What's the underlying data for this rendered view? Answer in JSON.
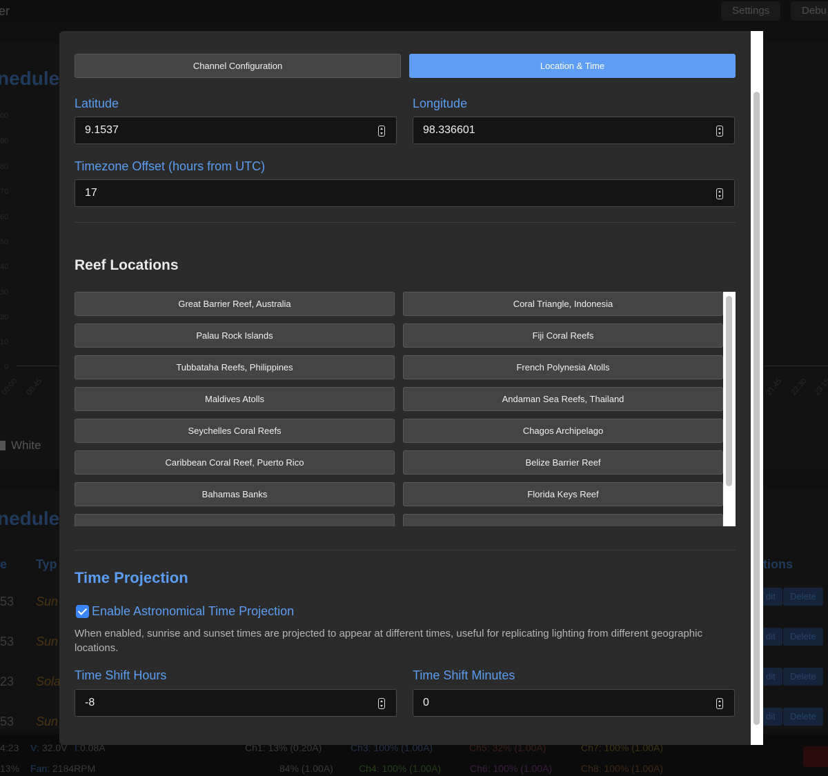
{
  "background": {
    "brand": "er",
    "header_buttons": [
      "Settings",
      "Debu"
    ],
    "section_titles": [
      "nedule",
      "nedule"
    ],
    "chart_y_ticks": [
      "00",
      "90",
      "80",
      "70",
      "60",
      "50",
      "40",
      "30",
      "20",
      "10",
      "0"
    ],
    "chart_x_ticks": [
      "00:00",
      "00:45",
      "21:45",
      "22:30",
      "23:15"
    ],
    "legend": "White",
    "table_headers": [
      "e",
      "Typ",
      "tions"
    ],
    "rows": [
      {
        "time": "53",
        "type": "Sun"
      },
      {
        "time": "53",
        "type": "Sun"
      },
      {
        "time": "23",
        "type": "Sola"
      },
      {
        "time": "53",
        "type": "Sun"
      }
    ],
    "edit_label": "dit",
    "delete_label": "Delete",
    "footer": {
      "line1_time": "4:23",
      "voltage_label": "V:",
      "voltage_value": "32.0V",
      "current_label": "I:",
      "current_value": "0.08A",
      "ch1": "Ch1: 13% (0.20A)",
      "ch3": "Ch3: 100% (1.00A)",
      "ch5": "Ch5: 32% (1.00A)",
      "ch7": "Ch7: 100% (1.00A)",
      "line2_pct": "13%",
      "fan_label": "Fan:",
      "fan_value": "2184RPM",
      "ch2": "84% (1.00A)",
      "ch4": "Ch4: 100% (1.00A)",
      "ch6": "Ch6: 100% (1.00A)",
      "ch8": "Ch8: 100% (1.00A)"
    }
  },
  "tabs": [
    {
      "label": "Channel Configuration",
      "active": false
    },
    {
      "label": "Location & Time",
      "active": true
    }
  ],
  "location": {
    "latitude_label": "Latitude",
    "latitude_value": "9.1537",
    "longitude_label": "Longitude",
    "longitude_value": "98.336601",
    "timezone_label": "Timezone Offset (hours from UTC)",
    "timezone_value": "17"
  },
  "reef": {
    "title": "Reef Locations",
    "locations": [
      "Great Barrier Reef, Australia",
      "Coral Triangle, Indonesia",
      "Palau Rock Islands",
      "Fiji Coral Reefs",
      "Tubbataha Reefs, Philippines",
      "French Polynesia Atolls",
      "Maldives Atolls",
      "Andaman Sea Reefs, Thailand",
      "Seychelles Coral Reefs",
      "Chagos Archipelago",
      "Caribbean Coral Reef, Puerto Rico",
      "Belize Barrier Reef",
      "Bahamas Banks",
      "Florida Keys Reef"
    ]
  },
  "projection": {
    "title": "Time Projection",
    "enable_label": "Enable Astronomical Time Projection",
    "enabled": true,
    "description": "When enabled, sunrise and sunset times are projected to appear at different times, useful for replicating lighting from different geographic locations.",
    "hours_label": "Time Shift Hours",
    "hours_value": "-8",
    "minutes_label": "Time Shift Minutes",
    "minutes_value": "0"
  },
  "colors": {
    "accent": "#5e9ef7",
    "label_blue": "#5b9df0",
    "modal_bg": "#2b2b2b",
    "input_bg": "#141414",
    "button_bg": "#444444"
  }
}
